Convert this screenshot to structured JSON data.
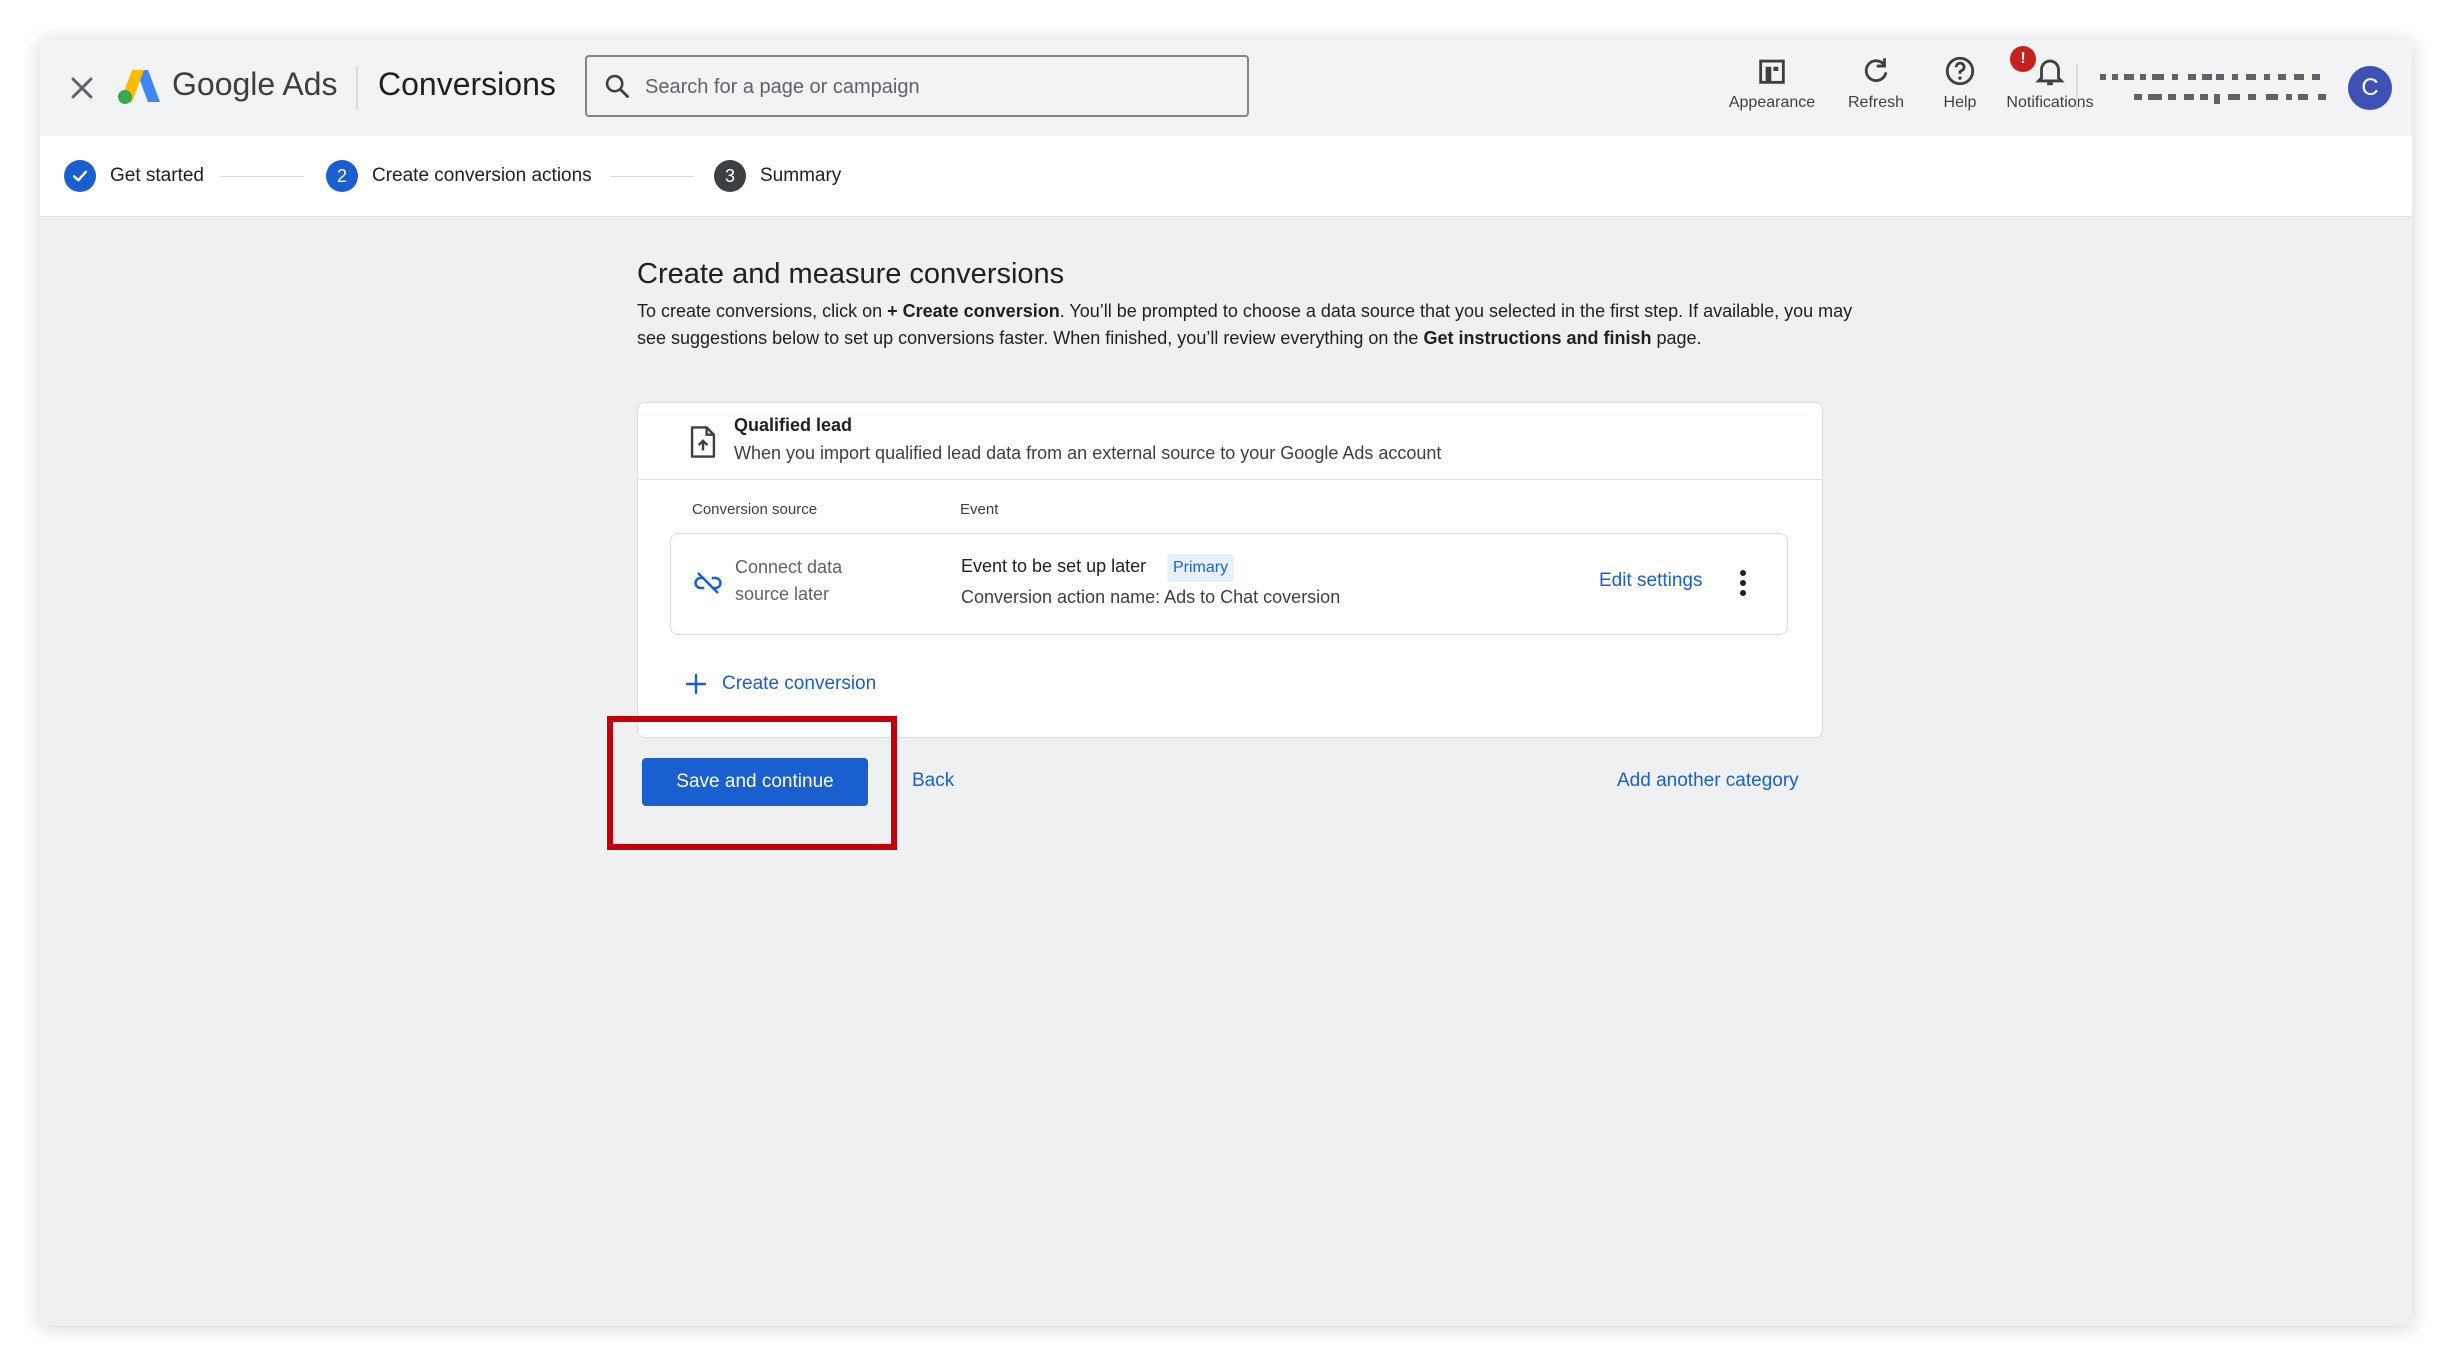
{
  "app": {
    "brand": "Google Ads",
    "page_title": "Conversions"
  },
  "search": {
    "placeholder": "Search for a page or campaign"
  },
  "toolbar": {
    "appearance": "Appearance",
    "refresh": "Refresh",
    "help": "Help",
    "notifications": "Notifications",
    "notifications_badge": "!"
  },
  "account": {
    "avatar_letter": "C"
  },
  "stepper": {
    "steps": [
      {
        "label": "Get started",
        "state": "complete"
      },
      {
        "number": "2",
        "label": "Create conversion actions",
        "state": "current"
      },
      {
        "number": "3",
        "label": "Summary",
        "state": "upcoming"
      }
    ]
  },
  "main": {
    "title": "Create and measure conversions",
    "intro_part1": "To create conversions, click on ",
    "intro_bold1": "+ Create conversion",
    "intro_part2": ". You’ll be prompted to choose a data source that you selected in the first step. If available, you may see suggestions below to set up conversions faster. When finished, you’ll review everything on the ",
    "intro_bold2": "Get instructions and finish",
    "intro_part3": " page."
  },
  "card": {
    "title": "Qualified lead",
    "description": "When you import qualified lead data from an external source to your Google Ads account",
    "col_source": "Conversion source",
    "col_event": "Event",
    "row": {
      "source_label": "Connect data source later",
      "event_name": "Event to be set up later",
      "chip": "Primary",
      "action_name": "Conversion action name: Ads to Chat coversion",
      "edit_label": "Edit settings"
    },
    "create_label": "Create conversion"
  },
  "actions": {
    "save_label": "Save and continue",
    "back_label": "Back",
    "add_category_label": "Add another category"
  },
  "colors": {
    "primary_blue": "#1a5fd0",
    "highlight_red": "#c4000b",
    "badge_red": "#c5221f",
    "avatar": "#3f51b5"
  }
}
